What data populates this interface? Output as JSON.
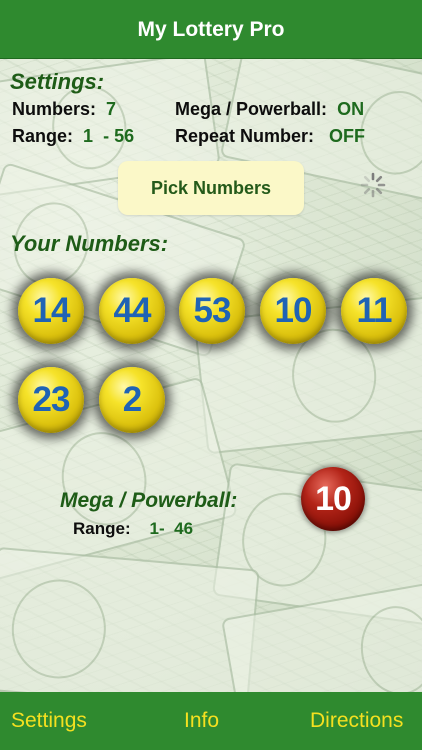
{
  "header": {
    "title": "My Lottery Pro"
  },
  "settings": {
    "heading": "Settings:",
    "numbers_label": "Numbers:",
    "numbers_value": "7",
    "range_label": "Range:",
    "range_min": "1",
    "range_sep": "-",
    "range_max": "56",
    "mega_label": "Mega / Powerball:",
    "mega_value": "ON",
    "repeat_label": "Repeat Number:",
    "repeat_value": "OFF"
  },
  "pick_button": {
    "label": "Pick Numbers"
  },
  "your_numbers": {
    "heading": "Your Numbers:",
    "balls": [
      "14",
      "44",
      "53",
      "10",
      "11",
      "23",
      "2"
    ]
  },
  "mega": {
    "heading": "Mega / Powerball:",
    "range_label": "Range:",
    "range_min": "1",
    "range_sep": "-",
    "range_max": "46",
    "value": "10"
  },
  "toolbar": {
    "settings_label": "Settings",
    "info_label": "Info",
    "directions_label": "Directions"
  },
  "colors": {
    "bar_green": "#2f8a2f",
    "heading_green": "#1e5c17",
    "value_green": "#1e6a1e",
    "toolbar_text": "#f4e020",
    "ball_yellow": "#f6e32a",
    "ball_number_blue": "#1f63b5",
    "mega_red": "#b32418",
    "button_bg": "#fbf8c8"
  },
  "icons": {
    "spinner": "activity-spinner-icon"
  }
}
